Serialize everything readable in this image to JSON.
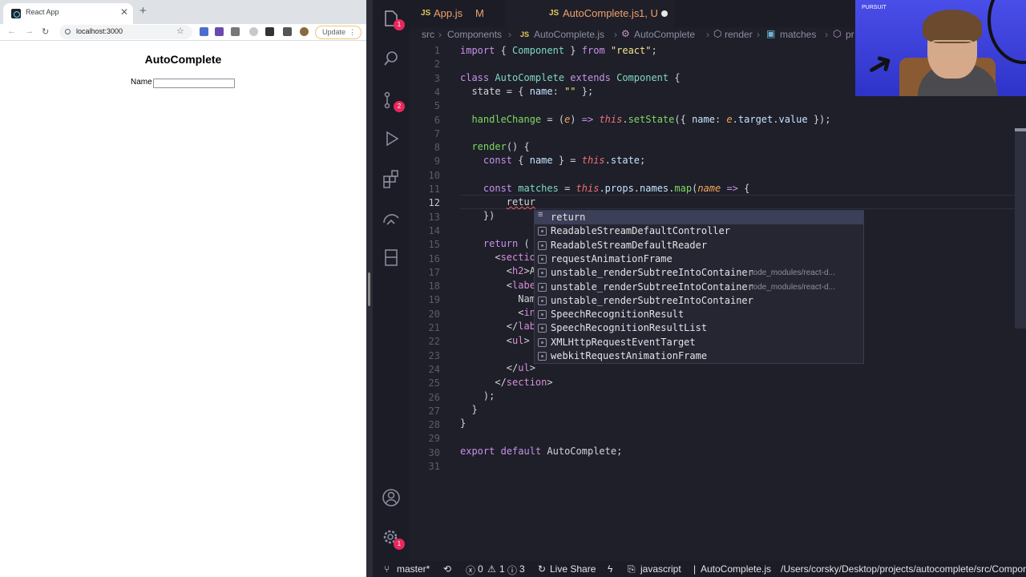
{
  "browser": {
    "tab_title": "React App",
    "tab_close": "✕",
    "new_tab": "+",
    "url": "localhost:3000",
    "update_label": "Update",
    "page": {
      "heading": "AutoComplete",
      "name_label": "Name"
    }
  },
  "editor": {
    "tabs": [
      {
        "label": "App.js",
        "status": "M"
      },
      {
        "label": "AutoComplete.js",
        "status": "1, U"
      }
    ],
    "breadcrumb": [
      "src",
      "Components",
      "AutoComplete.js",
      "AutoComplete",
      "render",
      "matches",
      "pr"
    ],
    "line_numbers": [
      "1",
      "2",
      "3",
      "4",
      "5",
      "6",
      "7",
      "8",
      "9",
      "10",
      "11",
      "12",
      "13",
      "14",
      "15",
      "16",
      "17",
      "18",
      "19",
      "20",
      "21",
      "22",
      "23",
      "24",
      "25",
      "26",
      "27",
      "28",
      "29",
      "30",
      "31"
    ],
    "current_line": "12",
    "lines": {
      "l1": [
        "import",
        " { ",
        "Component",
        " } ",
        "from",
        " ",
        "\"react\"",
        ";"
      ],
      "l3": [
        "class",
        " ",
        "AutoComplete",
        " ",
        "extends",
        " ",
        "Component",
        " {"
      ],
      "l4": [
        "  state",
        " = { ",
        "name",
        ": ",
        "\"\"",
        " };"
      ],
      "l6": [
        "  ",
        "handleChange",
        " = (",
        "e",
        ") ",
        "=>",
        " ",
        "this",
        ".",
        "setState",
        "({ ",
        "name",
        ": ",
        "e",
        ".",
        "target",
        ".",
        "value",
        " });"
      ],
      "l8": [
        "  ",
        "render",
        "() {"
      ],
      "l9": [
        "    ",
        "const",
        " { ",
        "name",
        " } = ",
        "this",
        ".",
        "state",
        ";"
      ],
      "l11": [
        "    ",
        "const",
        " ",
        "matches",
        " = ",
        "this",
        ".",
        "props",
        ".",
        "names",
        ".",
        "map",
        "(",
        "name",
        " ",
        "=>",
        " {"
      ],
      "l12": [
        "        ",
        "retur"
      ],
      "l13": [
        "    })"
      ],
      "l15": [
        "    ",
        "return",
        " ("
      ],
      "l16": [
        "      <",
        "sectio"
      ],
      "l17": [
        "        <",
        "h2",
        ">A"
      ],
      "l18": [
        "        <",
        "labe"
      ],
      "l19": [
        "          Nam"
      ],
      "l20": [
        "          <",
        "in"
      ],
      "l21": [
        "        </",
        "lab"
      ],
      "l22": [
        "        <",
        "ul",
        ">"
      ],
      "l24": [
        "        </",
        "ul",
        ">"
      ],
      "l25": [
        "      </",
        "section",
        ">"
      ],
      "l26": [
        "    );"
      ],
      "l27": [
        "  }"
      ],
      "l28": [
        "}"
      ],
      "l30": [
        "export",
        " ",
        "default",
        " AutoComplete;"
      ]
    },
    "suggestions": [
      {
        "label": "return",
        "detail": ""
      },
      {
        "label": "ReadableStreamDefaultController",
        "detail": ""
      },
      {
        "label": "ReadableStreamDefaultReader",
        "detail": ""
      },
      {
        "label": "requestAnimationFrame",
        "detail": ""
      },
      {
        "label": "unstable_renderSubtreeIntoContainer",
        "detail": "node_modules/react-d..."
      },
      {
        "label": "unstable_renderSubtreeIntoContainer",
        "detail": "node_modules/react-d..."
      },
      {
        "label": "unstable_renderSubtreeIntoContainer",
        "detail": ""
      },
      {
        "label": "SpeechRecognitionResult",
        "detail": ""
      },
      {
        "label": "SpeechRecognitionResultList",
        "detail": ""
      },
      {
        "label": "XMLHttpRequestEventTarget",
        "detail": ""
      },
      {
        "label": "webkitRequestAnimationFrame",
        "detail": ""
      }
    ]
  },
  "activity": {
    "explorer_badge": "1",
    "scm_badge": "2",
    "settings_badge": "1"
  },
  "statusbar": {
    "branch": "master*",
    "errors": "0",
    "warnings": "1",
    "infos": "3",
    "live_share": "Live Share",
    "language": "javascript",
    "file": "AutoComplete.js",
    "path": "/Users/corsky/Desktop/projects/autocomplete/src/Compone"
  },
  "webcam": {
    "logo_text": "PURSUIT"
  },
  "colors": {
    "editor_bg": "#1e1f29",
    "keyword": "#c792ea",
    "accent_badge": "#e8275d",
    "tab_text": "#f0a06a"
  }
}
